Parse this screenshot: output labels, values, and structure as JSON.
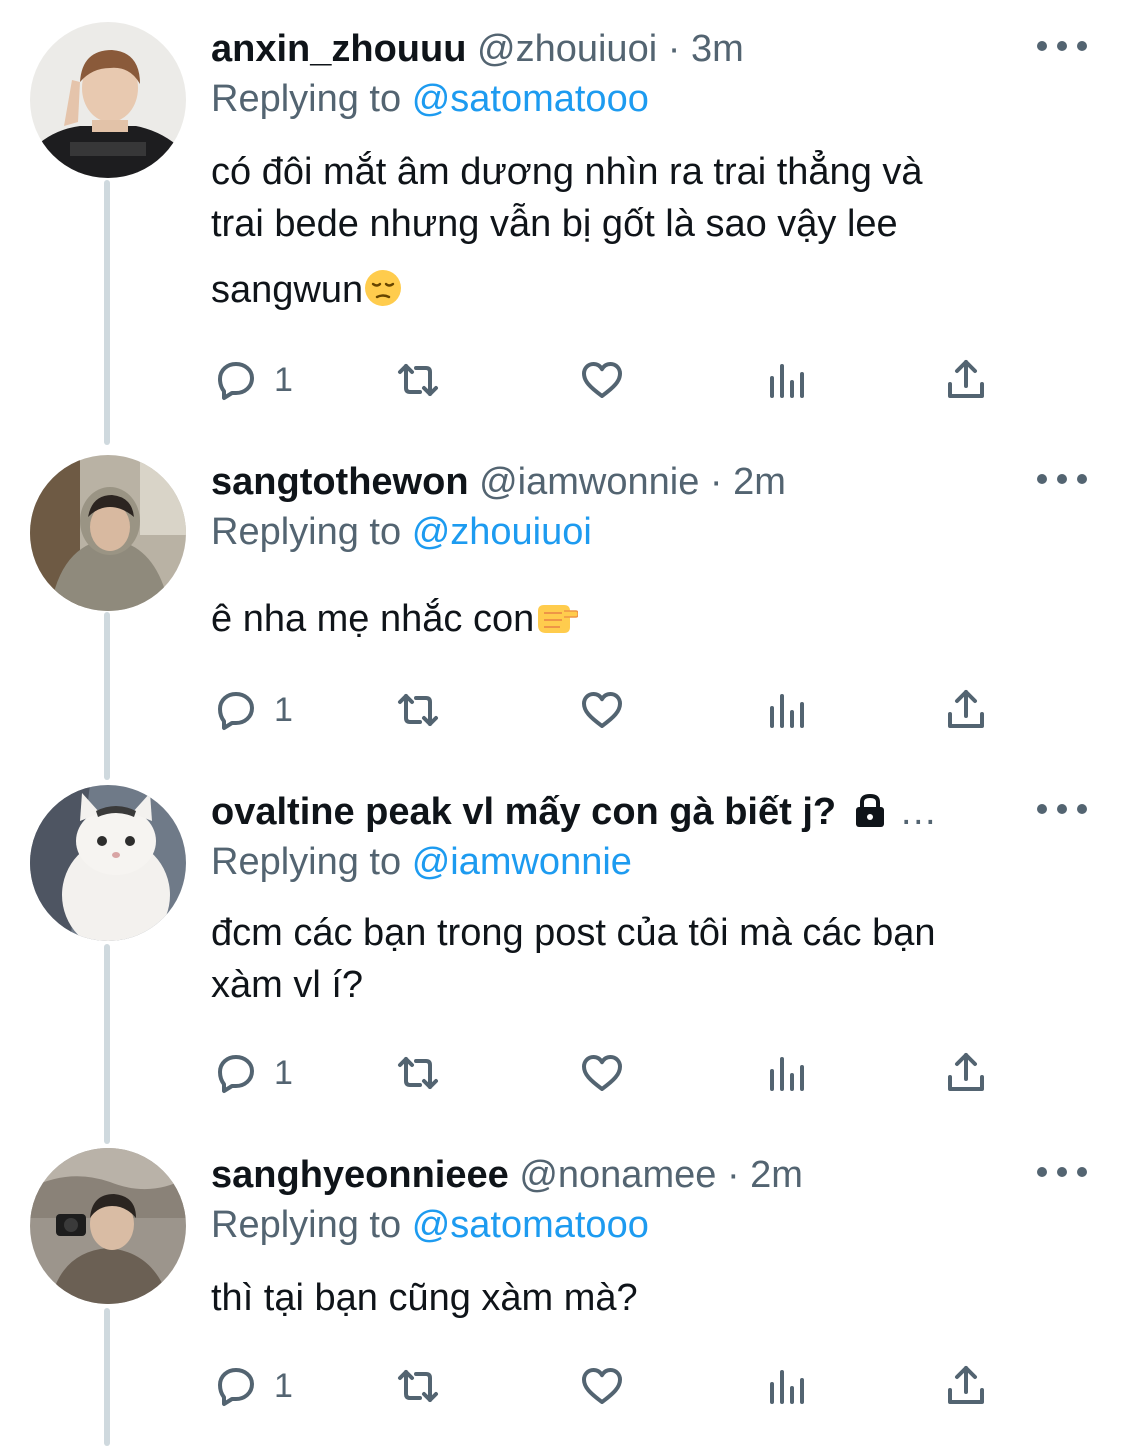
{
  "tweets": [
    {
      "name": "anxin_zhouuu",
      "handle": "@zhouiuoi",
      "time": "3m",
      "replying_label": "Replying to",
      "replying_to": "@satomatooo",
      "text_lines": [
        "có đôi mắt âm dương nhìn ra trai thẳng và",
        "trai bede nhưng vẫn bị gốt là sao vậy lee",
        "sangwun"
      ],
      "emoji": "pensive-face",
      "reply_count": "1"
    },
    {
      "name": "sangtothewon",
      "handle": "@iamwonnie",
      "time": "2m",
      "replying_label": "Replying to",
      "replying_to": "@zhouiuoi",
      "text_lines": [
        "ê nha mẹ nhắc con"
      ],
      "emoji": "pointing-fist",
      "reply_count": "1"
    },
    {
      "name": "ovaltine peak vl mấy con gà biết j?",
      "name_suffix": "…",
      "lock_icon": "lock-icon",
      "replying_label": "Replying to",
      "replying_to": "@iamwonnie",
      "text_lines": [
        "đcm các bạn trong post của tôi mà các bạn",
        "xàm vl í?"
      ],
      "reply_count": "1"
    },
    {
      "name": "sanghyeonnieee",
      "handle": "@nonamee",
      "time": "2m",
      "replying_label": "Replying to",
      "replying_to": "@satomatooo",
      "text_lines": [
        "thì tại bạn cũng xàm mà?"
      ],
      "reply_count": "1"
    }
  ],
  "separator": "·",
  "icons": [
    "reply-icon",
    "retweet-icon",
    "like-icon",
    "views-icon",
    "share-icon",
    "more-icon"
  ],
  "colors": {
    "text": "#0f1419",
    "secondary": "#536471",
    "link": "#1d9bf0",
    "thread_line": "#cfd9de"
  }
}
